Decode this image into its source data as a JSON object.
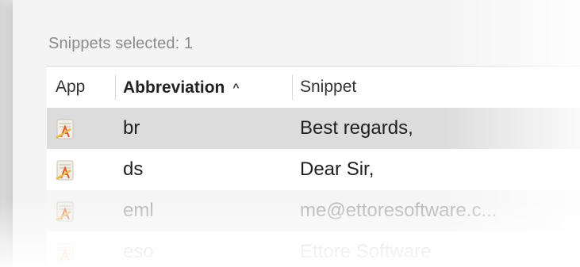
{
  "status": {
    "selected_text": "Snippets selected: 1"
  },
  "table": {
    "columns": {
      "app": "App",
      "abbreviation": "Abbreviation",
      "snippet": "Snippet"
    },
    "sort_column": "Abbreviation",
    "sort_direction": "ascending",
    "sort_icon": "chevron-up-icon",
    "rows": [
      {
        "app_icon": "text-edit-app-icon",
        "abbreviation": "br",
        "snippet": "Best regards,",
        "selected": true
      },
      {
        "app_icon": "text-edit-app-icon",
        "abbreviation": "ds",
        "snippet": "Dear Sir,",
        "selected": false
      },
      {
        "app_icon": "text-edit-app-icon",
        "abbreviation": "eml",
        "snippet": "me@ettoresoftware.c...",
        "selected": false
      },
      {
        "app_icon": "text-edit-app-icon",
        "abbreviation": "eso",
        "snippet": "Ettore Software",
        "selected": false
      }
    ]
  },
  "colors": {
    "selected_row": "#dcdcdc",
    "label_gray": "#8a8a8a",
    "text": "#1f1f1f"
  }
}
